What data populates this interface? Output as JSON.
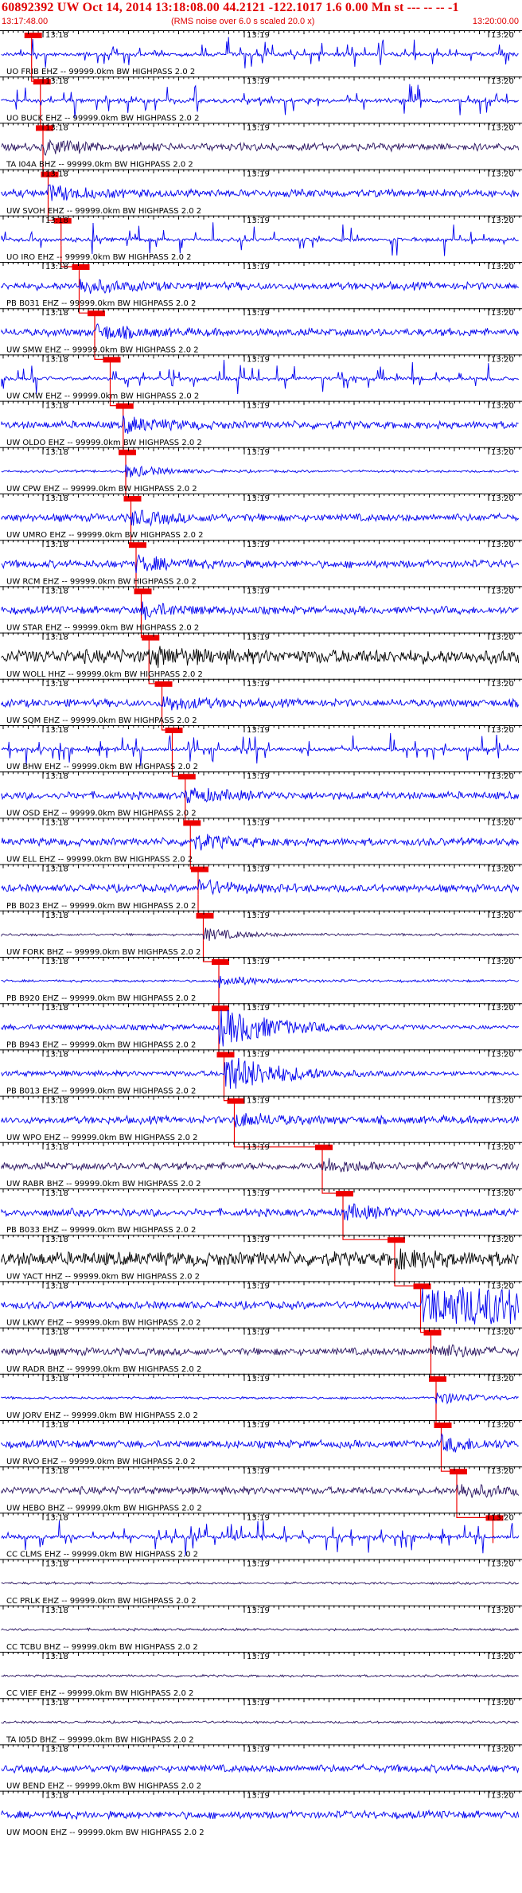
{
  "header": {
    "title": "60892392 UW Oct 14, 2014 13:18:08.00   44.2121 -122.1017  1.6 0.00 Mn st --- -- --  -1",
    "start_time": "13:17:48.00",
    "note": "(RMS noise over 6.0 s scaled 20.0 x)",
    "end_time": "13:20:00.00"
  },
  "tick_labels": [
    "13:18",
    "13:19",
    "13:20"
  ],
  "colors": {
    "trace_blue": "#0000ee",
    "trace_dark": "#2a1460",
    "trace_black": "#000000",
    "pick_red": "#ee0000",
    "header_red": "#e00000",
    "axis": "#000000"
  },
  "traces": [
    {
      "label": "UO FRIB EHZ -- 99999.0km BW  HIGHPASS  2.0  2",
      "color": "trace_blue",
      "style": "bursty",
      "pick": 0.058
    },
    {
      "label": "UO BUCK EHZ -- 99999.0km BW  HIGHPASS  2.0  2",
      "color": "trace_blue",
      "style": "bursty",
      "pick": 0.075
    },
    {
      "label": "TA I04A BHZ -- 99999.0km BW  HIGHPASS  2.0  2",
      "color": "trace_dark",
      "style": "noise",
      "pick": 0.08
    },
    {
      "label": "UW SVOH EHZ -- 99999.0km BW  HIGHPASS  2.0  2",
      "color": "trace_blue",
      "style": "noise",
      "pick": 0.09
    },
    {
      "label": "UO IRO EHZ -- 99999.0km BW  HIGHPASS  2.0  2",
      "color": "trace_blue",
      "style": "bursty",
      "pick": 0.115
    },
    {
      "label": "PB B031 EHZ -- 99999.0km BW  HIGHPASS  2.0  2",
      "color": "trace_blue",
      "style": "noise",
      "pick": 0.15
    },
    {
      "label": "UW SMW EHZ -- 99999.0km BW  HIGHPASS  2.0  2",
      "color": "trace_blue",
      "style": "noise",
      "pick": 0.18
    },
    {
      "label": "UW CMW EHZ -- 99999.0km BW  HIGHPASS  2.0  2",
      "color": "trace_blue",
      "style": "bursty",
      "pick": 0.21
    },
    {
      "label": "UW OLDO EHZ -- 99999.0km BW  HIGHPASS  2.0  2",
      "color": "trace_blue",
      "style": "noise",
      "pick": 0.235
    },
    {
      "label": "UW CPW EHZ -- 99999.0km BW  HIGHPASS  2.0  2",
      "color": "trace_blue",
      "style": "quiet",
      "pick": 0.24
    },
    {
      "label": "UW UMRO EHZ -- 99999.0km BW  HIGHPASS  2.0  2",
      "color": "trace_blue",
      "style": "noise",
      "pick": 0.25
    },
    {
      "label": "UW RCM EHZ -- 99999.0km BW  HIGHPASS  2.0  2",
      "color": "trace_blue",
      "style": "noise",
      "pick": 0.26
    },
    {
      "label": "UW STAR EHZ -- 99999.0km BW  HIGHPASS  2.0  2",
      "color": "trace_blue",
      "style": "noise",
      "pick": 0.27
    },
    {
      "label": "UW WOLL HHZ -- 99999.0km BW  HIGHPASS  2.0  2",
      "color": "trace_black",
      "style": "dense",
      "pick": 0.285
    },
    {
      "label": "UW SQM EHZ -- 99999.0km BW  HIGHPASS  2.0  2",
      "color": "trace_blue",
      "style": "noise",
      "pick": 0.31
    },
    {
      "label": "UW BHW EHZ -- 99999.0km BW  HIGHPASS  2.0  2",
      "color": "trace_blue",
      "style": "bursty",
      "pick": 0.33
    },
    {
      "label": "UW OSD EHZ -- 99999.0km BW  HIGHPASS  2.0  2",
      "color": "trace_blue",
      "style": "noise",
      "pick": 0.355
    },
    {
      "label": "UW ELL EHZ -- 99999.0km BW  HIGHPASS  2.0  2",
      "color": "trace_blue",
      "style": "noise",
      "pick": 0.365
    },
    {
      "label": "PB B023 EHZ -- 99999.0km BW  HIGHPASS  2.0  2",
      "color": "trace_blue",
      "style": "noise",
      "pick": 0.38
    },
    {
      "label": "UW FORK BHZ -- 99999.0km BW  HIGHPASS  2.0  2",
      "color": "trace_dark",
      "style": "quiet",
      "pick": 0.39
    },
    {
      "label": "PB B920 EHZ -- 99999.0km BW  HIGHPASS  2.0  2",
      "color": "trace_blue",
      "style": "quiet",
      "pick": 0.42
    },
    {
      "label": "PB B943 EHZ -- 99999.0km BW  HIGHPASS  2.0  2",
      "color": "trace_blue",
      "style": "event",
      "pick": 0.42
    },
    {
      "label": "PB B013 EHZ -- 99999.0km BW  HIGHPASS  2.0  2",
      "color": "trace_blue",
      "style": "event",
      "pick": 0.43
    },
    {
      "label": "UW WPO EHZ -- 99999.0km BW  HIGHPASS  2.0  2",
      "color": "trace_blue",
      "style": "noise",
      "pick": 0.45
    },
    {
      "label": "UW RABR BHZ -- 99999.0km BW  HIGHPASS  2.0  2",
      "color": "trace_dark",
      "style": "noise",
      "pick": 0.62
    },
    {
      "label": "PB B033 EHZ -- 99999.0km BW  HIGHPASS  2.0  2",
      "color": "trace_blue",
      "style": "noise",
      "pick": 0.66
    },
    {
      "label": "UW YACT HHZ -- 99999.0km BW  HIGHPASS  2.0  2",
      "color": "trace_black",
      "style": "dense",
      "pick": 0.76
    },
    {
      "label": "UW LKWY EHZ -- 99999.0km BW  HIGHPASS  2.0  2",
      "color": "trace_blue",
      "style": "blob",
      "pick": 0.81
    },
    {
      "label": "UW RADR BHZ -- 99999.0km BW  HIGHPASS  2.0  2",
      "color": "trace_dark",
      "style": "noise",
      "pick": 0.83
    },
    {
      "label": "UW JORV EHZ -- 99999.0km BW  HIGHPASS  2.0  2",
      "color": "trace_blue",
      "style": "quiet",
      "pick": 0.84
    },
    {
      "label": "UW RVO EHZ -- 99999.0km BW  HIGHPASS  2.0  2",
      "color": "trace_blue",
      "style": "noise",
      "pick": 0.85
    },
    {
      "label": "UW HEBO BHZ -- 99999.0km BW  HIGHPASS  2.0  2",
      "color": "trace_dark",
      "style": "noise",
      "pick": 0.88
    },
    {
      "label": "CC CLMS EHZ -- 99999.0km BW  HIGHPASS  2.0  2",
      "color": "trace_blue",
      "style": "bursty",
      "pick": 0.95
    },
    {
      "label": "CC PRLK EHZ -- 99999.0km BW  HIGHPASS  2.0  2",
      "color": "trace_dark",
      "style": "quiet",
      "pick": null
    },
    {
      "label": "CC TCBU BHZ -- 99999.0km BW  HIGHPASS  2.0  2",
      "color": "trace_dark",
      "style": "quiet",
      "pick": null
    },
    {
      "label": "CC VIEF EHZ -- 99999.0km BW  HIGHPASS  2.0  2",
      "color": "trace_dark",
      "style": "quiet",
      "pick": null
    },
    {
      "label": "TA I05D BHZ -- 99999.0km BW  HIGHPASS  2.0  2",
      "color": "trace_dark",
      "style": "quiet",
      "pick": null
    },
    {
      "label": "UW BEND EHZ -- 99999.0km BW  HIGHPASS  2.0  2",
      "color": "trace_blue",
      "style": "noise",
      "pick": null
    },
    {
      "label": "UW MOON EHZ -- 99999.0km BW  HIGHPASS  2.0  2",
      "color": "trace_blue",
      "style": "noise",
      "pick": null
    }
  ]
}
